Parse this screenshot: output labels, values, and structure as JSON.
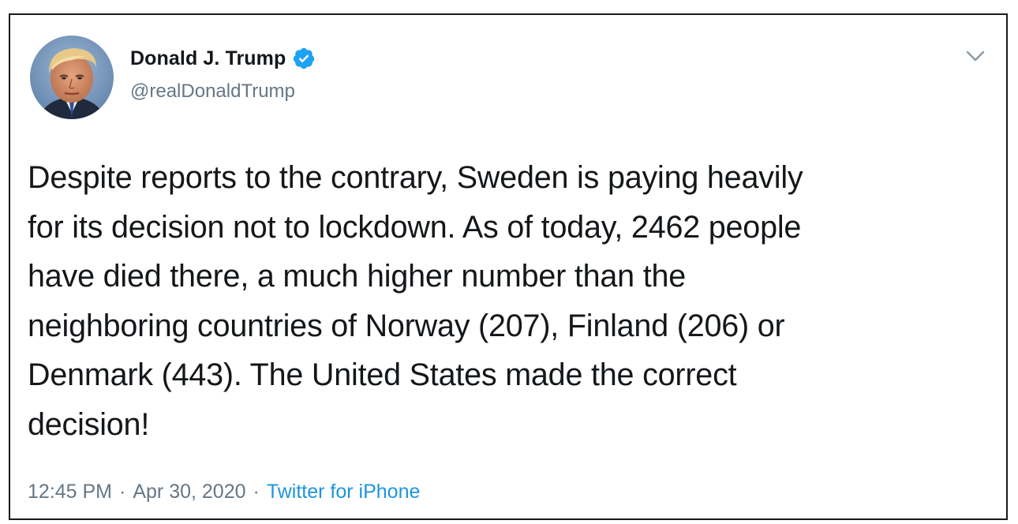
{
  "tweet": {
    "display_name": "Donald J. Trump",
    "handle": "@realDonaldTrump",
    "verified": true,
    "text": "Despite reports to the contrary, Sweden is paying heavily\nfor its decision not to lockdown. As of today, 2462 people\nhave died there, a much higher number than the\nneighboring countries of Norway (207), Finland (206) or\nDenmark (443). The United States made the correct\ndecision!",
    "time": "12:45 PM",
    "separator": "·",
    "date": "Apr 30, 2020",
    "source": "Twitter for iPhone"
  },
  "icons": {
    "verified": "verified-badge-icon",
    "menu": "chevron-down-icon"
  },
  "colors": {
    "text_primary": "#14171a",
    "text_secondary": "#657786",
    "link": "#1b95e0",
    "verified_badge": "#1da1f2"
  }
}
